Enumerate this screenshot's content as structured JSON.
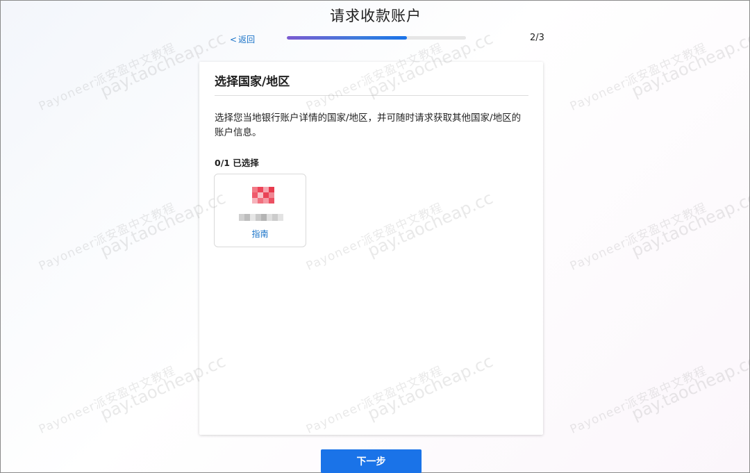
{
  "header": {
    "title": "请求收款账户",
    "back_label": "返回",
    "step_counter": "2/3",
    "progress": 0.67
  },
  "card": {
    "title": "选择国家/地区",
    "description": "选择您当地银行账户详情的国家/地区，并可随时请求获取其他国家/地区的账户信息。",
    "selected_count": "0/1 已选择",
    "country_tile": {
      "guide_label": "指南",
      "flag_colors": [
        "#f27a86",
        "#ee4458",
        "#f5a5b0",
        "#e83a4d",
        "#ef5a6b",
        "#f7c2c8",
        "#e94356",
        "#f08794",
        "#f6b3bb",
        "#f1707e",
        "#f59aa5",
        "#ec5062"
      ],
      "name_blur_colors": [
        "#d0d0d0",
        "#bdbdbd",
        "#e6e6e6",
        "#c9c9c9",
        "#b4b4b4",
        "#dedede",
        "#cccccc",
        "#e3e3e3"
      ]
    }
  },
  "footer": {
    "next_label": "下一步"
  },
  "watermark": {
    "line1": "Payoneer派安盈中文教程",
    "line2": "pay.taocheap.cc"
  },
  "colors": {
    "accent": "#1a73e8",
    "link": "#1a73c8"
  }
}
